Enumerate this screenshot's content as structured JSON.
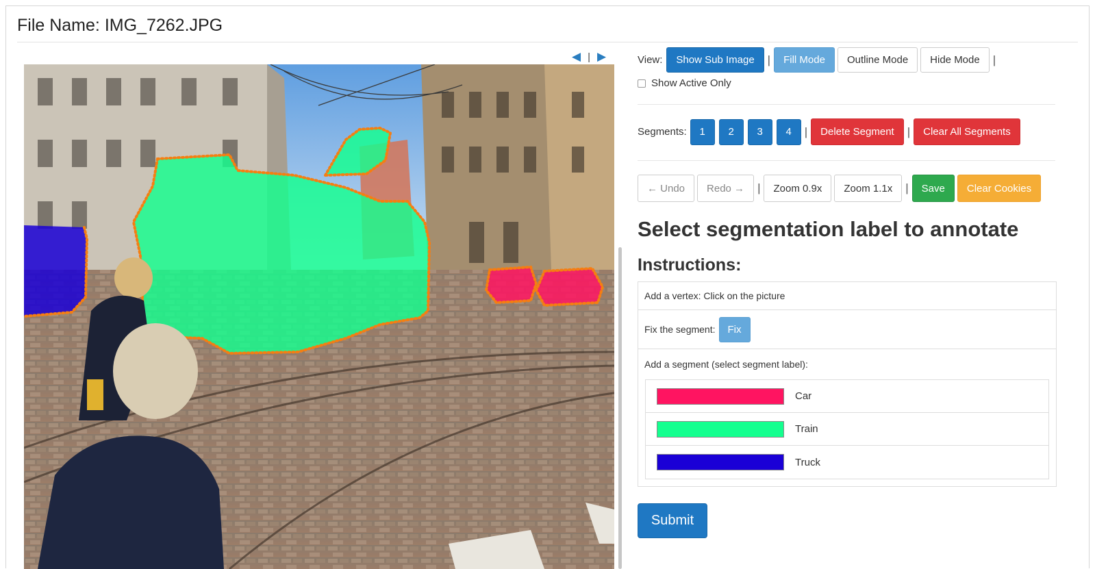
{
  "file": {
    "label": "File Name:",
    "name": "IMG_7262.JPG"
  },
  "pager": {
    "prev_icon": "triangle-left",
    "next_icon": "triangle-right",
    "separator": "|"
  },
  "view": {
    "label": "View:",
    "show_sub_image": "Show Sub Image",
    "fill_mode": "Fill Mode",
    "outline_mode": "Outline Mode",
    "hide_mode": "Hide Mode",
    "show_active_only": "Show Active Only",
    "show_active_only_checked": false
  },
  "segments": {
    "label": "Segments:",
    "numbers": [
      "1",
      "2",
      "3",
      "4"
    ],
    "delete": "Delete Segment",
    "clear_all": "Clear All Segments"
  },
  "toolbar": {
    "undo": "← Undo",
    "redo": "Redo →",
    "zoom_out": "Zoom 0.9x",
    "zoom_in": "Zoom 1.1x",
    "save": "Save",
    "clear_cookies": "Clear Cookies"
  },
  "heading": "Select segmentation label to annotate",
  "instructions": {
    "title": "Instructions:",
    "add_vertex": "Add a vertex: Click on the picture",
    "fix_label": "Fix the segment:",
    "fix_button": "Fix",
    "add_segment": "Add a segment (select segment label):"
  },
  "labels": [
    {
      "name": "Car",
      "color": "#ff1461"
    },
    {
      "name": "Train",
      "color": "#14ff8f"
    },
    {
      "name": "Truck",
      "color": "#1a00d6"
    }
  ],
  "submit": "Submit",
  "colors": {
    "primary": "#1f78c3",
    "primary_light": "#65a9dc",
    "danger": "#e0353a",
    "success": "#2ea94e",
    "warning": "#f5ad36",
    "vertex": "#f57e12"
  }
}
